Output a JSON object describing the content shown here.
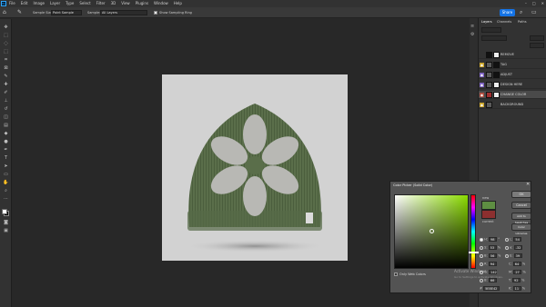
{
  "app": {
    "logo": "Ps"
  },
  "menu": [
    "File",
    "Edit",
    "Image",
    "Layer",
    "Type",
    "Select",
    "Filter",
    "3D",
    "View",
    "Plugins",
    "Window",
    "Help"
  ],
  "window_controls": [
    "–",
    "□",
    "✕"
  ],
  "options_bar": {
    "sample_size_label": "Sample Size:",
    "sample_size_value": "Point Sample",
    "sample_label": "Sample:",
    "sample_value": "All Layers",
    "sampling_ring_label": "Show Sampling Ring",
    "share_label": "Share"
  },
  "layers_panel": {
    "tabs": [
      "Layers",
      "Channels",
      "Paths"
    ],
    "layers": [
      {
        "name": "REMOVE",
        "eye": "",
        "thumb_color": "#111111",
        "mask_color": "#eeeeee"
      },
      {
        "name": "TAG",
        "eye": "◉",
        "eye_color": "#c9a227",
        "thumb_color": "#5a5a5a",
        "mask_color": "#111111"
      },
      {
        "name": "ADJUST",
        "eye": "◉",
        "eye_color": "#7a5fc0",
        "thumb_color": "#5a5a5a",
        "mask_color": "#111111"
      },
      {
        "name": "DESIGN HERE",
        "eye": "◉",
        "eye_color": "#7a5fc0",
        "thumb_color": "#5a5a5a",
        "mask_color": "#eeeeee"
      },
      {
        "name": "CHANGE COLOR",
        "eye": "◉",
        "eye_color": "#b14a3b",
        "thumb_color": "#a03030",
        "mask_color": "#eeeeee"
      },
      {
        "name": "BACKGROUND",
        "eye": "◉",
        "eye_color": "#c9a227",
        "thumb_color": "#5a5a5a",
        "mask_color": ""
      }
    ]
  },
  "color_picker": {
    "title": "Color Picker (Solid Color)",
    "new_label": "new",
    "current_label": "current",
    "new_color": "#5e8e42",
    "current_color": "#8c2f2f",
    "buttons": {
      "ok": "OK",
      "cancel": "Cancel",
      "add_swatches": "Add to Swatches",
      "color_libraries": "Color Libraries"
    },
    "web_colors_label": "Only Web Colors",
    "fields": [
      {
        "label": "H:",
        "value": "98",
        "unit": "°",
        "selected": true
      },
      {
        "label": "S:",
        "value": "53",
        "unit": "%",
        "selected": false
      },
      {
        "label": "B:",
        "value": "56",
        "unit": "%",
        "selected": false
      },
      {
        "label": "R:",
        "value": "94",
        "unit": "",
        "selected": false
      },
      {
        "label": "G:",
        "value": "142",
        "unit": "",
        "selected": false
      },
      {
        "label": "B:",
        "value": "66",
        "unit": "",
        "selected": false
      }
    ],
    "lab_fields": [
      {
        "label": "L:",
        "value": "54",
        "unit": ""
      },
      {
        "label": "a:",
        "value": "-32",
        "unit": ""
      },
      {
        "label": "b:",
        "value": "39",
        "unit": ""
      },
      {
        "label": "C:",
        "value": "64",
        "unit": "%"
      },
      {
        "label": "M:",
        "value": "27",
        "unit": "%"
      },
      {
        "label": "Y:",
        "value": "92",
        "unit": "%"
      },
      {
        "label": "K:",
        "value": "11",
        "unit": "%"
      }
    ],
    "hex_label": "#",
    "hex_value": "5E8E42"
  },
  "watermark": {
    "line1": "Activate Windows",
    "line2": "Go to Settings to activate Windows."
  }
}
